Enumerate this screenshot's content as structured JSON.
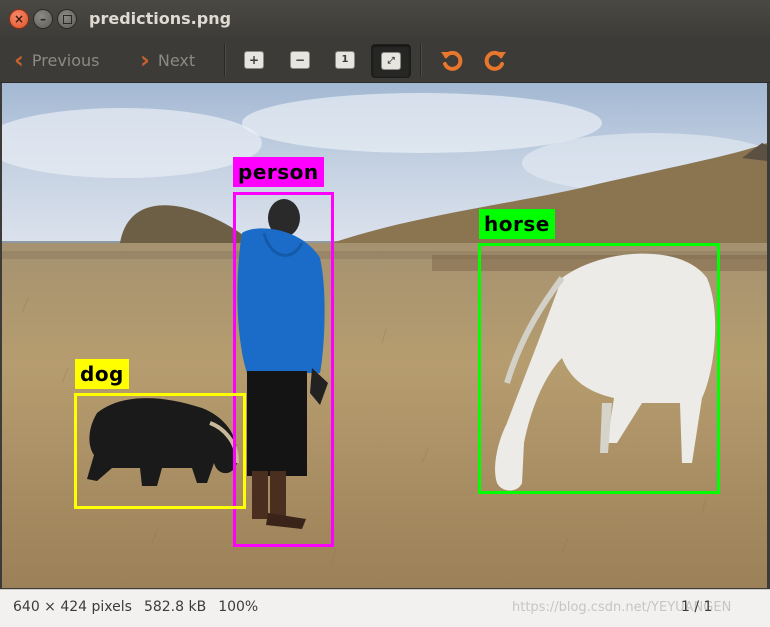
{
  "window": {
    "title": "predictions.png"
  },
  "toolbar": {
    "previous_label": "Previous",
    "next_label": "Next",
    "tools": [
      "zoom-in-icon",
      "zoom-out-icon",
      "normal-size-icon",
      "best-fit-icon",
      "rotate-left-icon",
      "rotate-right-icon"
    ]
  },
  "detections": {
    "person": {
      "label": "person",
      "color": "#ff00ff"
    },
    "horse": {
      "label": "horse",
      "color": "#00ff00"
    },
    "dog": {
      "label": "dog",
      "color": "#ffff00"
    }
  },
  "statusbar": {
    "dimensions": "640 × 424 pixels",
    "size": "582.8 kB",
    "zoom": "100%",
    "page": "1 / 1",
    "watermark": "https://blog.csdn.net/YEYUANGEN"
  },
  "colors": {
    "accent_orange": "#c4622d"
  }
}
